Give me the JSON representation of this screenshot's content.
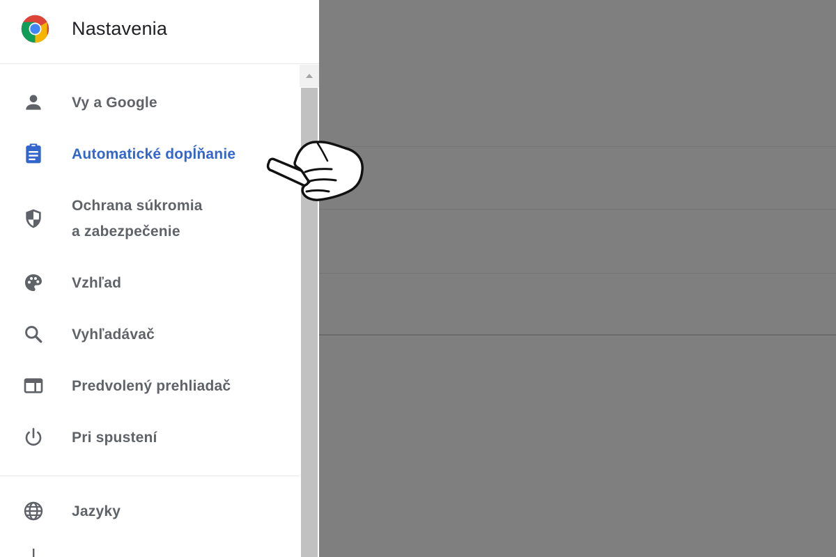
{
  "header": {
    "title": "Nastavenia",
    "logo_icon": "chrome-logo-icon"
  },
  "sidebar": {
    "items": [
      {
        "label": "Vy a Google",
        "icon": "person-icon",
        "active": false
      },
      {
        "label": "Automatické dopĺňanie",
        "icon": "clipboard-icon",
        "active": true
      },
      {
        "label_line1": "Ochrana súkromia",
        "label_line2": "a zabezpečenie",
        "icon": "shield-icon",
        "active": false
      },
      {
        "label": "Vzhľad",
        "icon": "palette-icon",
        "active": false
      },
      {
        "label": "Vyhľadávač",
        "icon": "search-icon",
        "active": false
      },
      {
        "label": "Predvolený prehliadač",
        "icon": "browser-window-icon",
        "active": false
      },
      {
        "label": "Pri spustení",
        "icon": "power-icon",
        "active": false
      },
      {
        "label": "Jazyky",
        "icon": "globe-icon",
        "active": false
      }
    ]
  },
  "colors": {
    "active": "#3366cc",
    "text": "#5f6368",
    "overlay": "#7f7f7f"
  },
  "pointer": {
    "icon": "pointing-hand-icon"
  }
}
